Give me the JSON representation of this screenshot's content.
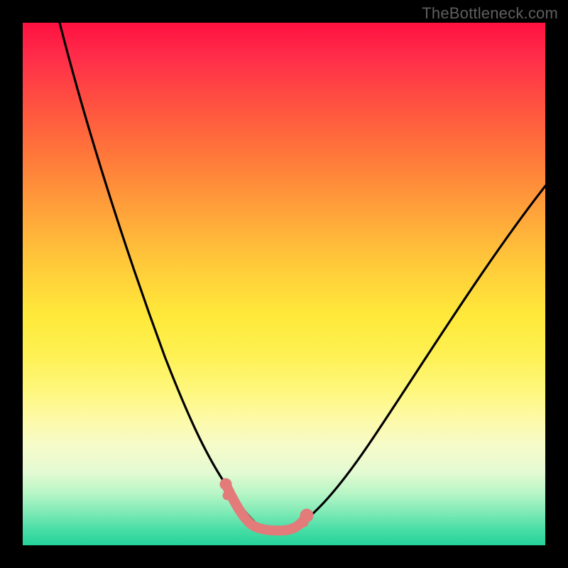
{
  "watermark": "TheBottleneck.com",
  "colors": {
    "frame": "#000000",
    "curve": "#000000",
    "marker": "#e27b79",
    "gradient_top": "#ff1040",
    "gradient_bottom": "#24d39a"
  },
  "chart_data": {
    "type": "line",
    "title": "",
    "xlabel": "",
    "ylabel": "",
    "xlim": [
      0,
      100
    ],
    "ylim": [
      0,
      100
    ],
    "grid": false,
    "legend": false,
    "series": [
      {
        "name": "bottleneck-curve",
        "x": [
          7,
          10,
          13,
          16,
          19,
          22,
          25,
          28,
          30,
          32,
          34,
          36,
          38,
          40,
          42,
          44,
          46,
          48,
          50,
          55,
          60,
          65,
          70,
          75,
          80,
          85,
          90,
          95,
          100
        ],
        "y": [
          100,
          90,
          80,
          71,
          62,
          54,
          46,
          38,
          33,
          28,
          23,
          19,
          15,
          11,
          8,
          5,
          3,
          2,
          2,
          4,
          9,
          16,
          24,
          32,
          40,
          48,
          55,
          62,
          68
        ]
      }
    ],
    "markers": {
      "name": "highlight-segment",
      "x": [
        38,
        40,
        42,
        44,
        46,
        48,
        50,
        52
      ],
      "y": [
        14,
        10,
        7,
        5,
        3.5,
        3,
        3,
        4
      ]
    }
  }
}
